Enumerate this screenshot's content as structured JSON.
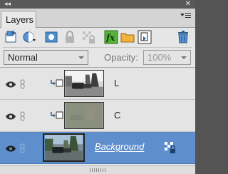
{
  "window": {
    "collapse_glyph": "◂◂",
    "close_glyph": "✕"
  },
  "tabs": [
    {
      "label": "Layers"
    }
  ],
  "toolbar": {
    "icons": [
      "new-layer-icon",
      "new-adjustment-layer-icon",
      "layer-mask-icon",
      "lock-all-icon",
      "lock-transparency-icon",
      "fx-styles-icon",
      "new-group-icon",
      "clip-icon",
      "delete-layer-icon"
    ],
    "fx_label": "fx"
  },
  "blend_mode": {
    "value": "Normal"
  },
  "opacity": {
    "label": "Opacity:",
    "value": "100%"
  },
  "layers": [
    {
      "name": "L",
      "visible": true,
      "clipped": true,
      "selected": false
    },
    {
      "name": "C",
      "visible": true,
      "clipped": true,
      "selected": false
    },
    {
      "name": "Background",
      "visible": true,
      "clipped": false,
      "selected": true,
      "locked": true
    }
  ],
  "colors": {
    "selection": "#5e8fcc",
    "panel": "#e6e6e6",
    "fx_green": "#3b8a1e"
  }
}
